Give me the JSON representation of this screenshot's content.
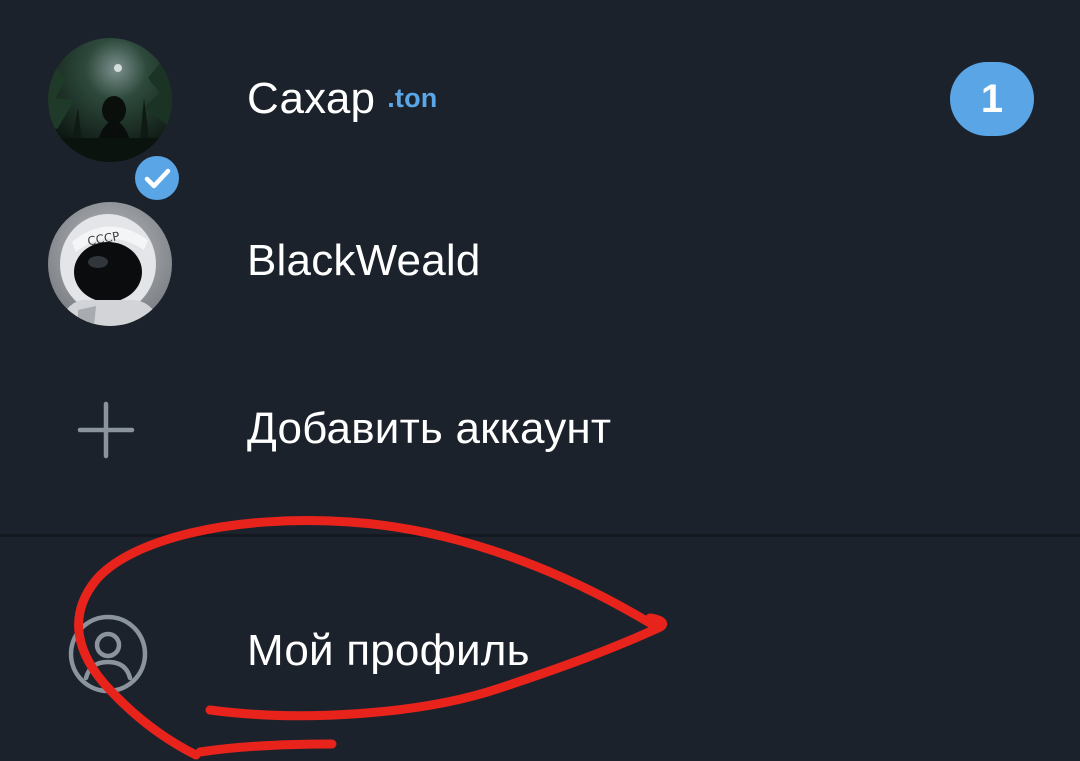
{
  "accounts": [
    {
      "name": "Сахар",
      "suffix": ".ton",
      "unread": "1",
      "verified": true,
      "avatar_icon": "forest-silhouette-avatar"
    },
    {
      "name": "BlackWeald",
      "avatar_icon": "cosmonaut-avatar",
      "helmet_text": "СССР"
    }
  ],
  "add_account": {
    "label": "Добавить аккаунт",
    "icon": "plus-icon"
  },
  "my_profile": {
    "label": "Мой профиль",
    "icon": "user-circle-icon"
  },
  "colors": {
    "background": "#1c222b",
    "accent": "#5aa5e5",
    "text": "#ffffff",
    "icon": "#8b949c",
    "annotation": "#e8231c"
  }
}
